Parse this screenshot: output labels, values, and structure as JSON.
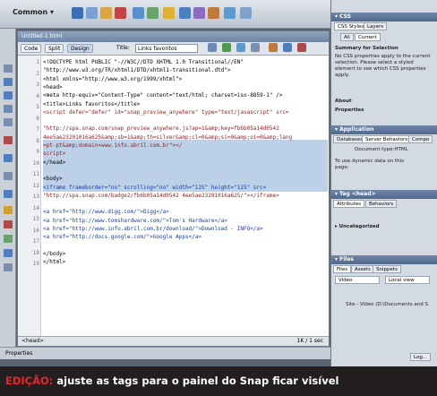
{
  "toolbar": {
    "common_label": "Common ▾"
  },
  "doc": {
    "filename": "Untitled-1.html",
    "buttons": [
      "Code",
      "Split",
      "Design"
    ],
    "title_label": "Title:",
    "title_value": "Links favoritos",
    "status_text": "1K / 1 sec",
    "tag_path": "<head>"
  },
  "line_numbers": [
    "1",
    "2",
    "3",
    "4",
    "5",
    "6",
    "7",
    "8",
    "9",
    "10",
    "11",
    "12",
    "13",
    "14",
    "15",
    "16",
    "17",
    "18",
    "19"
  ],
  "code_lines": [
    "<!DOCTYPE html PUBLIC \"-//W3C//DTD XHTML 1.0 Transitional//EN\"",
    "\"http://www.w3.org/TR/xhtml1/DTD/xhtml1-transitional.dtd\">",
    "<html xmlns=\"http://www.w3.org/1999/xhtml\">",
    "<head>",
    "<meta http-equiv=\"Content-Type\" content=\"text/html; charset=iso-8859-1\" />",
    "<title>Links favoritos</title>",
    "<script defer=\"defer\" id=\"snap_preview_anywhere\" type=\"text/javascript\" src=",
    "",
    "\"http://spa.snap.com/snap_preview_anywhere.js?ap=1&amp;key=fb6b05a14d0542",
    "4ee5ae23201016a625&amp;sb=1&amp;th=silver&amp;cl=0&amp;si=0&amp;oi=0&amp;lang",
    "=pt-pt&amp;domain=www.info.abril.com.br\"></",
    "script>",
    "</head>",
    "",
    "<body>",
    "<iframe frameborder=\"no\" scrolling=\"no\" width=\"125\" height=\"125\" src=",
    "\"http://spa.snap.com/badge2/fb6b05a14d0542 4ee5ae23201016a625/\"></iframe>",
    "",
    "<a href=\"http://www.digg.com/\">Digg</a>",
    "<a href=\"http://www.tomshardware.com/\">Tom's Hardware</a>",
    "<a href=\"http://www.info.abril.com.br/download/\">Download - INFO</a>",
    "<a href=\"http://docs.google.com/\">Google Apps</a>",
    "",
    "</body>",
    "</html>"
  ],
  "panel": {
    "css_title": "▾ CSS",
    "css_tabs": [
      "CSS Styles",
      "Layers"
    ],
    "css_subtabs": [
      "All",
      "Current"
    ],
    "summary_label": "Summary for Selection",
    "summary_text": [
      "No CSS properties apply to the current",
      "selection. Please select a styled",
      "element to see which CSS properties",
      "apply."
    ],
    "about_label": "About",
    "properties_label": "Properties",
    "app_title": "▾ Application",
    "app_tabs": [
      "Databases",
      "Server Behaviors",
      "Compo"
    ],
    "doc_type_label": "Document type:HTML",
    "dyn_text": [
      "To use dynamic data on this",
      "page:"
    ],
    "tag_title": "▾ Tag <head>",
    "tag_tabs": [
      "Attributes",
      "Behaviors"
    ],
    "uncategorized": "▸ Uncategorized",
    "files_title": "▾ Files",
    "files_tabs": [
      "Files",
      "Assets",
      "Snippets"
    ],
    "files_select": "Video",
    "files_view": "Local view",
    "site_label": "Site - Video (D:\\Documents and S",
    "log_button": "Log..."
  },
  "caption": {
    "highlight": "EDIÇÃO:",
    "text": " ajuste as tags para o painel do Snap ficar visível"
  },
  "colors": {
    "caption_bg": "#231f20",
    "caption_accent": "#e8262a",
    "selection": "#bcd0e8",
    "panel_header": "#50688c"
  }
}
